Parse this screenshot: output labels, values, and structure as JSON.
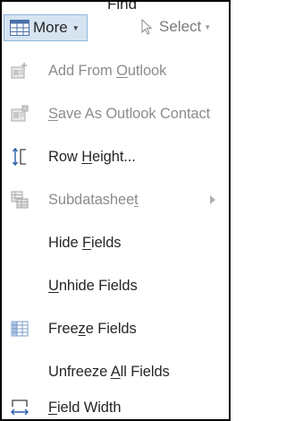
{
  "ribbon": {
    "more_label": "More",
    "more_icon": "datasheet-grid-icon",
    "find_label": "Find",
    "select_label": "Select",
    "select_icon": "cursor-arrow-icon"
  },
  "menu": {
    "items": [
      {
        "pre": "Add From ",
        "key": "O",
        "post": "utlook",
        "enabled": false,
        "icon": "add-from-outlook-icon"
      },
      {
        "pre": "",
        "key": "S",
        "post": "ave As Outlook Contact",
        "enabled": false,
        "icon": "save-as-outlook-contact-icon"
      },
      {
        "pre": "Row ",
        "key": "H",
        "post": "eight...",
        "enabled": true,
        "icon": "row-height-icon"
      },
      {
        "pre": "Subdatashee",
        "key": "t",
        "post": "",
        "enabled": false,
        "icon": "subdatasheet-icon",
        "has_submenu": true
      },
      {
        "pre": "Hide ",
        "key": "F",
        "post": "ields",
        "enabled": true,
        "icon": ""
      },
      {
        "pre": "",
        "key": "U",
        "post": "nhide Fields",
        "enabled": true,
        "icon": ""
      },
      {
        "pre": "Free",
        "key": "z",
        "post": "e Fields",
        "enabled": true,
        "icon": "freeze-fields-icon"
      },
      {
        "pre": "Unfreeze ",
        "key": "A",
        "post": "ll Fields",
        "enabled": true,
        "icon": ""
      },
      {
        "pre": "",
        "key": "F",
        "post": "ield Width",
        "enabled": true,
        "icon": "field-width-icon"
      }
    ]
  },
  "colors": {
    "more_button_bg": "#d6e4f2",
    "more_button_border": "#8fb5dc",
    "text": "#262626",
    "disabled_text": "#8c8c8c",
    "frame_border": "#000000"
  }
}
